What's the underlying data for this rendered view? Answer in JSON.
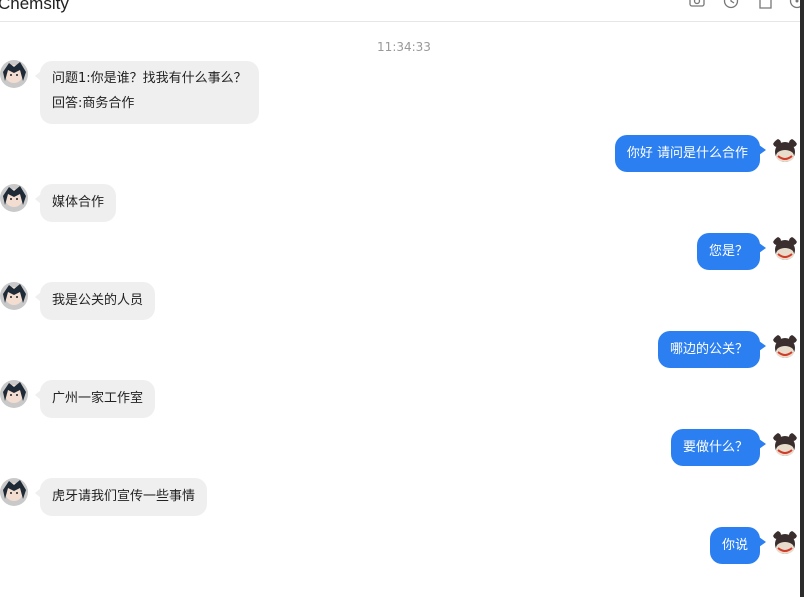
{
  "header": {
    "title": "Chemsity",
    "icons": [
      "screenshot-icon",
      "history-icon",
      "file-icon",
      "more-icon"
    ]
  },
  "chat": {
    "timestamp": "11:34:33",
    "messages": [
      {
        "side": "in",
        "lines": [
          "问题1:你是谁？找我有什么事么？",
          "回答:商务合作"
        ]
      },
      {
        "side": "out",
        "lines": [
          "你好 请问是什么合作"
        ]
      },
      {
        "side": "in",
        "lines": [
          "媒体合作"
        ]
      },
      {
        "side": "out",
        "lines": [
          "您是？"
        ]
      },
      {
        "side": "in",
        "lines": [
          "我是公关的人员"
        ]
      },
      {
        "side": "out",
        "lines": [
          "哪边的公关？"
        ]
      },
      {
        "side": "in",
        "lines": [
          "广州一家工作室"
        ]
      },
      {
        "side": "out",
        "lines": [
          "要做什么？"
        ]
      },
      {
        "side": "in",
        "lines": [
          "虎牙请我们宣传一些事情"
        ]
      },
      {
        "side": "out",
        "lines": [
          "你说"
        ]
      }
    ]
  },
  "colors": {
    "outgoing_bubble": "#2b7ff0",
    "incoming_bubble": "#efefef",
    "timestamp": "#999999"
  }
}
